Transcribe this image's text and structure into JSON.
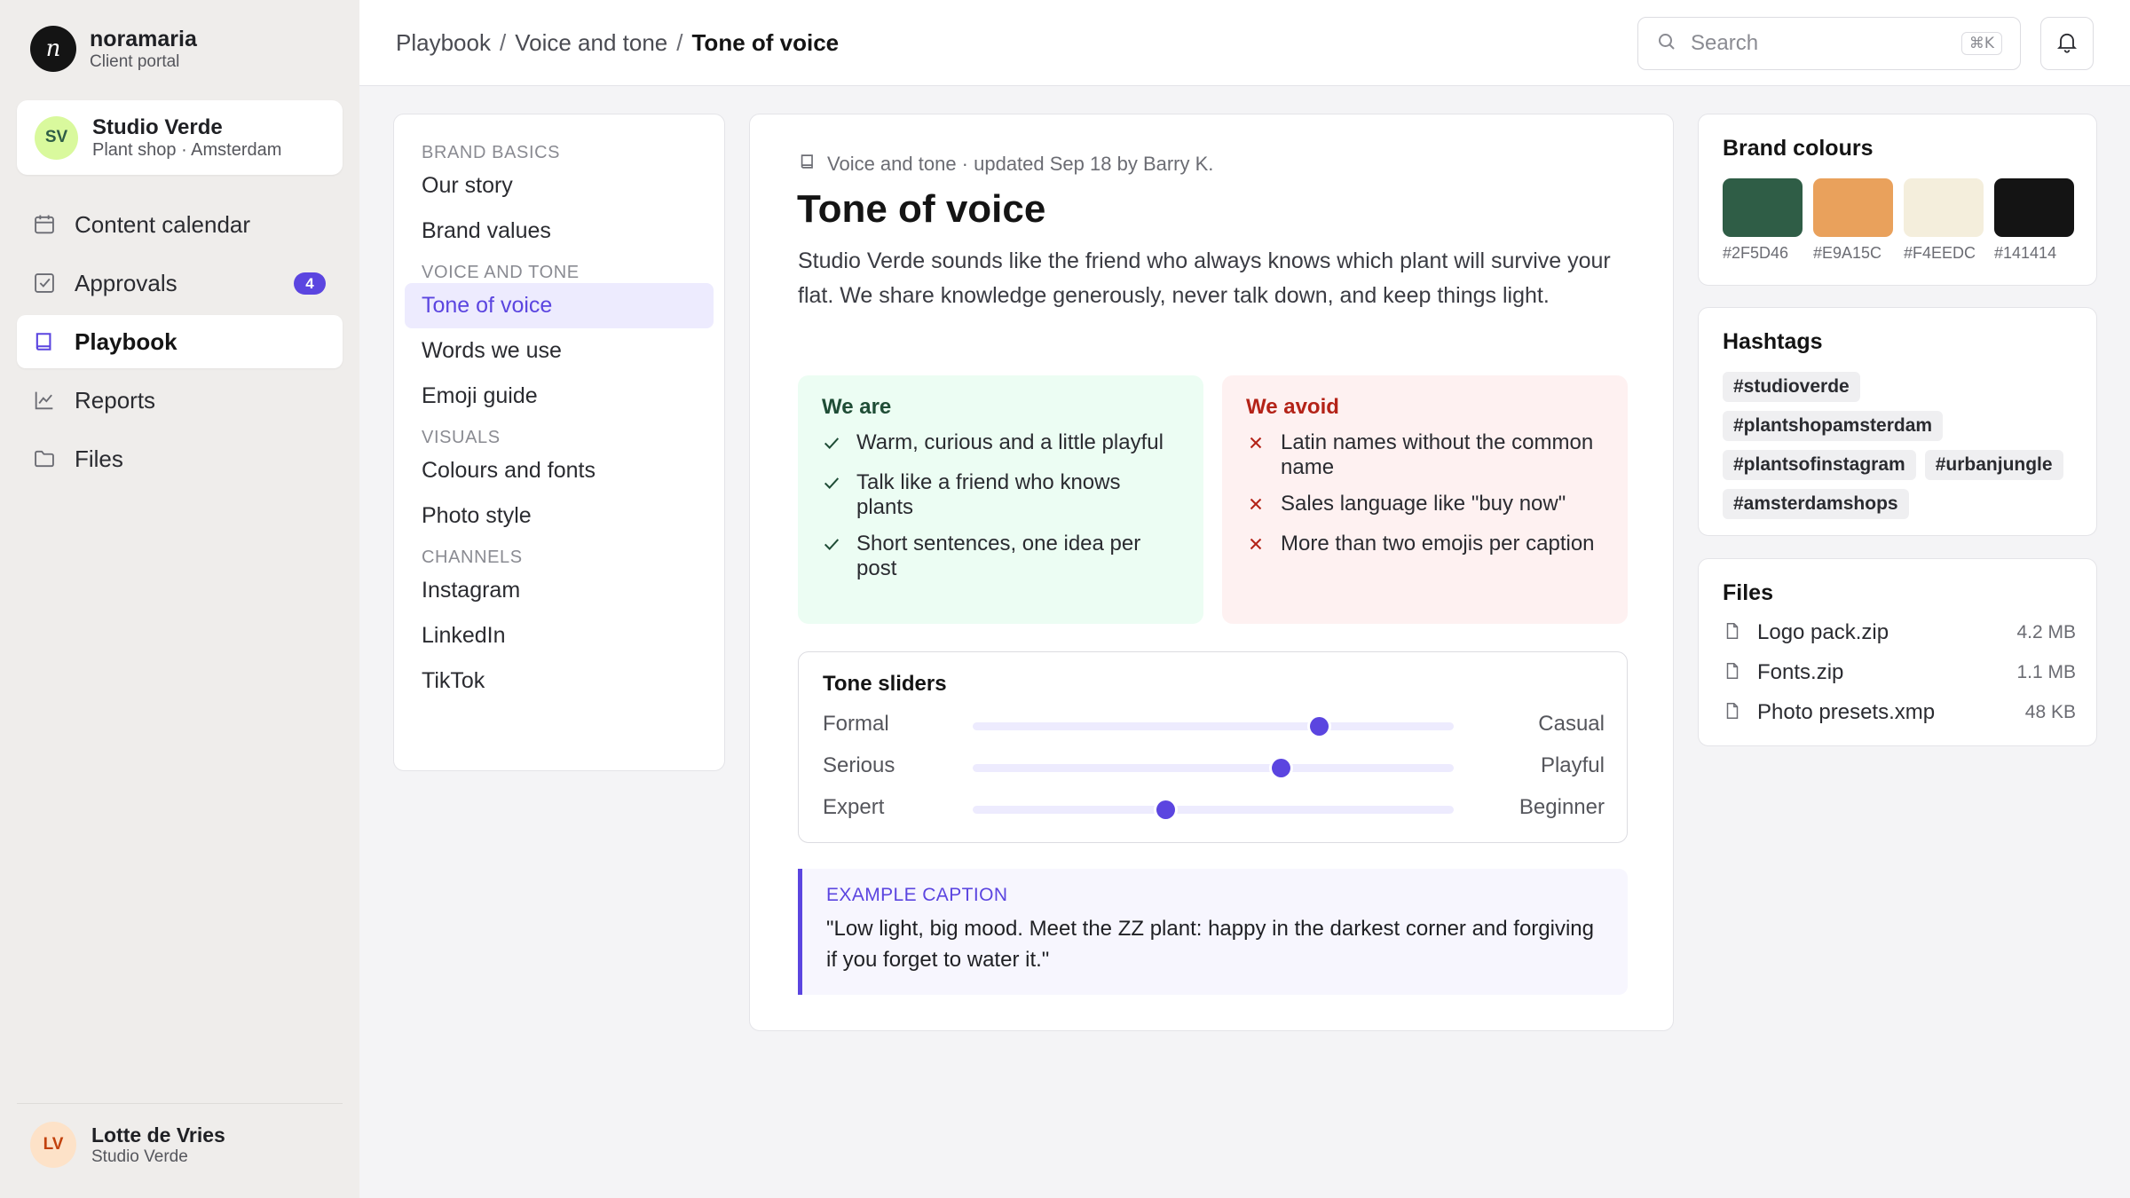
{
  "org": {
    "logo_letter": "n",
    "name": "noramaria",
    "subtitle": "Client portal"
  },
  "client": {
    "initials": "SV",
    "name": "Studio Verde",
    "subtitle": "Plant shop · Amsterdam"
  },
  "nav": [
    {
      "label": "Content calendar",
      "icon": "calendar-icon"
    },
    {
      "label": "Approvals",
      "icon": "checkbox-icon",
      "badge": "4"
    },
    {
      "label": "Playbook",
      "icon": "book-icon",
      "active": true
    },
    {
      "label": "Reports",
      "icon": "chart-line-icon"
    },
    {
      "label": "Files",
      "icon": "folder-icon"
    }
  ],
  "user": {
    "initials": "LV",
    "name": "Lotte de Vries",
    "subtitle": "Studio Verde"
  },
  "breadcrumb": {
    "items": [
      "Playbook",
      "Voice and tone"
    ],
    "separator": "/",
    "current": "Tone of voice"
  },
  "search": {
    "placeholder": "Search",
    "shortcut": "⌘K"
  },
  "playbook_nav": {
    "sections": [
      {
        "title": "BRAND BASICS",
        "items": [
          "Our story",
          "Brand values"
        ]
      },
      {
        "title": "VOICE AND TONE",
        "items": [
          "Tone of voice",
          "Words we use",
          "Emoji guide"
        ]
      },
      {
        "title": "VISUALS",
        "items": [
          "Colours and fonts",
          "Photo style"
        ]
      },
      {
        "title": "CHANNELS",
        "items": [
          "Instagram",
          "LinkedIn",
          "TikTok"
        ]
      }
    ],
    "active": "Tone of voice"
  },
  "article": {
    "meta": "Voice and tone · updated Sep 18 by Barry K.",
    "title": "Tone of voice",
    "intro": "Studio Verde sounds like the friend who always knows which plant will survive your flat. We share knowledge generously, never talk down, and keep things light.",
    "we_are": {
      "title": "We are",
      "items": [
        "Warm, curious and a little playful",
        "Talk like a friend who knows plants",
        "Short sentences, one idea per post"
      ]
    },
    "we_avoid": {
      "title": "We avoid",
      "items": [
        "Latin names without the common name",
        "Sales language like \"buy now\"",
        "More than two emojis per caption"
      ]
    },
    "tone_sliders": {
      "title": "Tone sliders",
      "rows": [
        {
          "left": "Formal",
          "right": "Casual",
          "value": 0.72
        },
        {
          "left": "Serious",
          "right": "Playful",
          "value": 0.64
        },
        {
          "left": "Expert",
          "right": "Beginner",
          "value": 0.4
        }
      ]
    },
    "example": {
      "label": "EXAMPLE CAPTION",
      "text": "\"Low light, big mood. Meet the ZZ plant: happy in the darkest corner and forgiving if you forget to water it.\""
    }
  },
  "brand_colours": {
    "title": "Brand colours",
    "swatches": [
      "#2F5D46",
      "#E9A15C",
      "#F4EEDC",
      "#141414"
    ]
  },
  "hashtags": {
    "title": "Hashtags",
    "tags": [
      "#studioverde",
      "#plantshopamsterdam",
      "#plantsofinstagram",
      "#urbanjungle",
      "#amsterdamshops"
    ]
  },
  "files": {
    "title": "Files",
    "items": [
      {
        "name": "Logo pack.zip",
        "size": "4.2 MB"
      },
      {
        "name": "Fonts.zip",
        "size": "1.1 MB"
      },
      {
        "name": "Photo presets.xmp",
        "size": "48 KB"
      }
    ]
  },
  "colors": {
    "accent": "#5B45E0",
    "accent_soft": "#EDEBFE",
    "positive_bg": "#ECFDF3",
    "negative_bg": "#FEF1F1",
    "negative": "#B42318"
  }
}
